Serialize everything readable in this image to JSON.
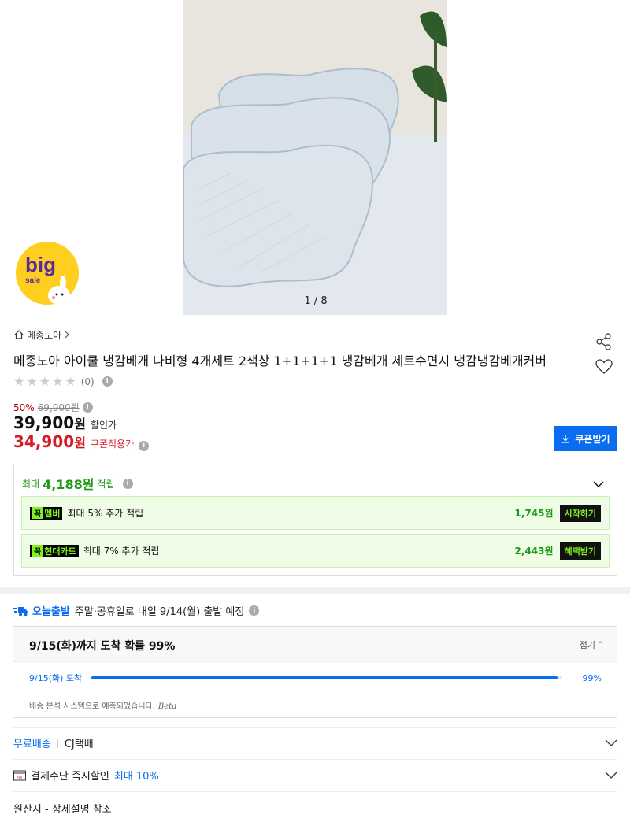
{
  "gallery": {
    "counter": "1 / 8"
  },
  "badge": {
    "line1": "big",
    "line2": "sale"
  },
  "store": {
    "name": "메종노아"
  },
  "product": {
    "title": "메종노아 아이쿨 냉감베개 나비형 4개세트 2색상 1+1+1+1 냉감베개 세트수면시 냉감냉감베개커버",
    "review_count": "(0)",
    "rating_stars": 0
  },
  "price": {
    "discount_rate": "50%",
    "original": "69,900원",
    "sale": "39,900",
    "sale_unit": "원",
    "sale_label": "할인가",
    "coupon": "34,900",
    "coupon_unit": "원",
    "coupon_label": "쿠폰적용가"
  },
  "coupon_button": {
    "label": "쿠폰받기"
  },
  "points": {
    "prefix": "최대",
    "amount": "4,188원",
    "suffix": "적립",
    "benefits": [
      {
        "tag_k": "꼭",
        "tag_name": "멤버",
        "text": "최대 5% 추가 적립",
        "amount": "1,745원",
        "button": "시작하기"
      },
      {
        "tag_k": "꼭",
        "tag_name": "현대카드",
        "text": "최대 7% 추가 적립",
        "amount": "2,443원",
        "button": "혜택받기"
      }
    ]
  },
  "delivery": {
    "today_badge": "오늘출발",
    "today_message": "주말·공휴일로 내일 9/14(월) 출발 예정",
    "arrival_title": "9/15(화)까지 도착 확률 99%",
    "fold_label": "접기",
    "bar_label": "9/15(화) 도착",
    "bar_percent": "99%",
    "bar_fraction": 0.99,
    "note": "배송 분석 시스템으로 예측되었습니다.",
    "note_beta": "Beta",
    "free_shipping": "무료배송",
    "carrier": "CJ택배",
    "pay_text": "결제수단 즉시할인",
    "pay_max": "최대 10%",
    "origin": "원산지 - 상세설명 참조"
  },
  "colors": {
    "accent": "#0a6df1",
    "sale_red": "#d51c25",
    "points_green": "#1c9a17",
    "neon": "#7ff020"
  }
}
